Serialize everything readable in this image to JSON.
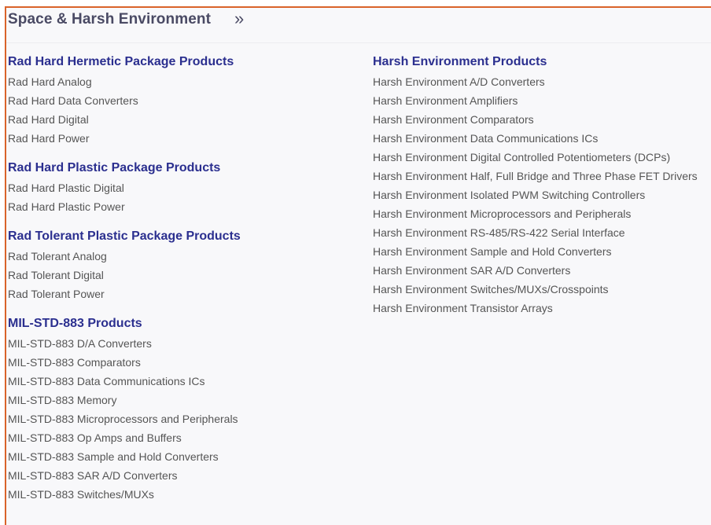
{
  "header": {
    "title": "Space & Harsh Environment",
    "expand_icon": "double-chevron-right-icon",
    "expand_glyph": "»"
  },
  "colors": {
    "accent_border": "#d9632a",
    "heading": "#2b2f8f",
    "link": "#555555"
  },
  "left_groups": [
    {
      "title": "Rad Hard Hermetic Package Products",
      "items": [
        "Rad Hard Analog",
        "Rad Hard Data Converters",
        "Rad Hard Digital",
        "Rad Hard Power"
      ]
    },
    {
      "title": "Rad Hard Plastic Package Products",
      "items": [
        "Rad Hard Plastic Digital",
        "Rad Hard Plastic Power"
      ]
    },
    {
      "title": "Rad Tolerant Plastic Package Products",
      "items": [
        "Rad Tolerant Analog",
        "Rad Tolerant Digital",
        "Rad Tolerant Power"
      ]
    },
    {
      "title": "MIL-STD-883 Products",
      "items": [
        "MIL-STD-883 D/A Converters",
        "MIL-STD-883 Comparators",
        "MIL-STD-883 Data Communications ICs",
        "MIL-STD-883 Memory",
        "MIL-STD-883 Microprocessors and Peripherals",
        "MIL-STD-883 Op Amps and Buffers",
        "MIL-STD-883 Sample and Hold Converters",
        "MIL-STD-883 SAR A/D Converters",
        "MIL-STD-883 Switches/MUXs"
      ]
    }
  ],
  "right_groups": [
    {
      "title": "Harsh Environment Products",
      "items": [
        "Harsh Environment A/D Converters",
        "Harsh Environment Amplifiers",
        "Harsh Environment Comparators",
        "Harsh Environment Data Communications ICs",
        "Harsh Environment Digital Controlled Potentiometers (DCPs)",
        "Harsh Environment Half, Full Bridge and Three Phase FET Drivers",
        "Harsh Environment Isolated PWM Switching Controllers",
        "Harsh Environment Microprocessors and Peripherals",
        "Harsh Environment RS-485/RS-422 Serial Interface",
        "Harsh Environment Sample and Hold Converters",
        "Harsh Environment SAR A/D Converters",
        "Harsh Environment Switches/MUXs/Crosspoints",
        "Harsh Environment Transistor Arrays"
      ]
    }
  ]
}
